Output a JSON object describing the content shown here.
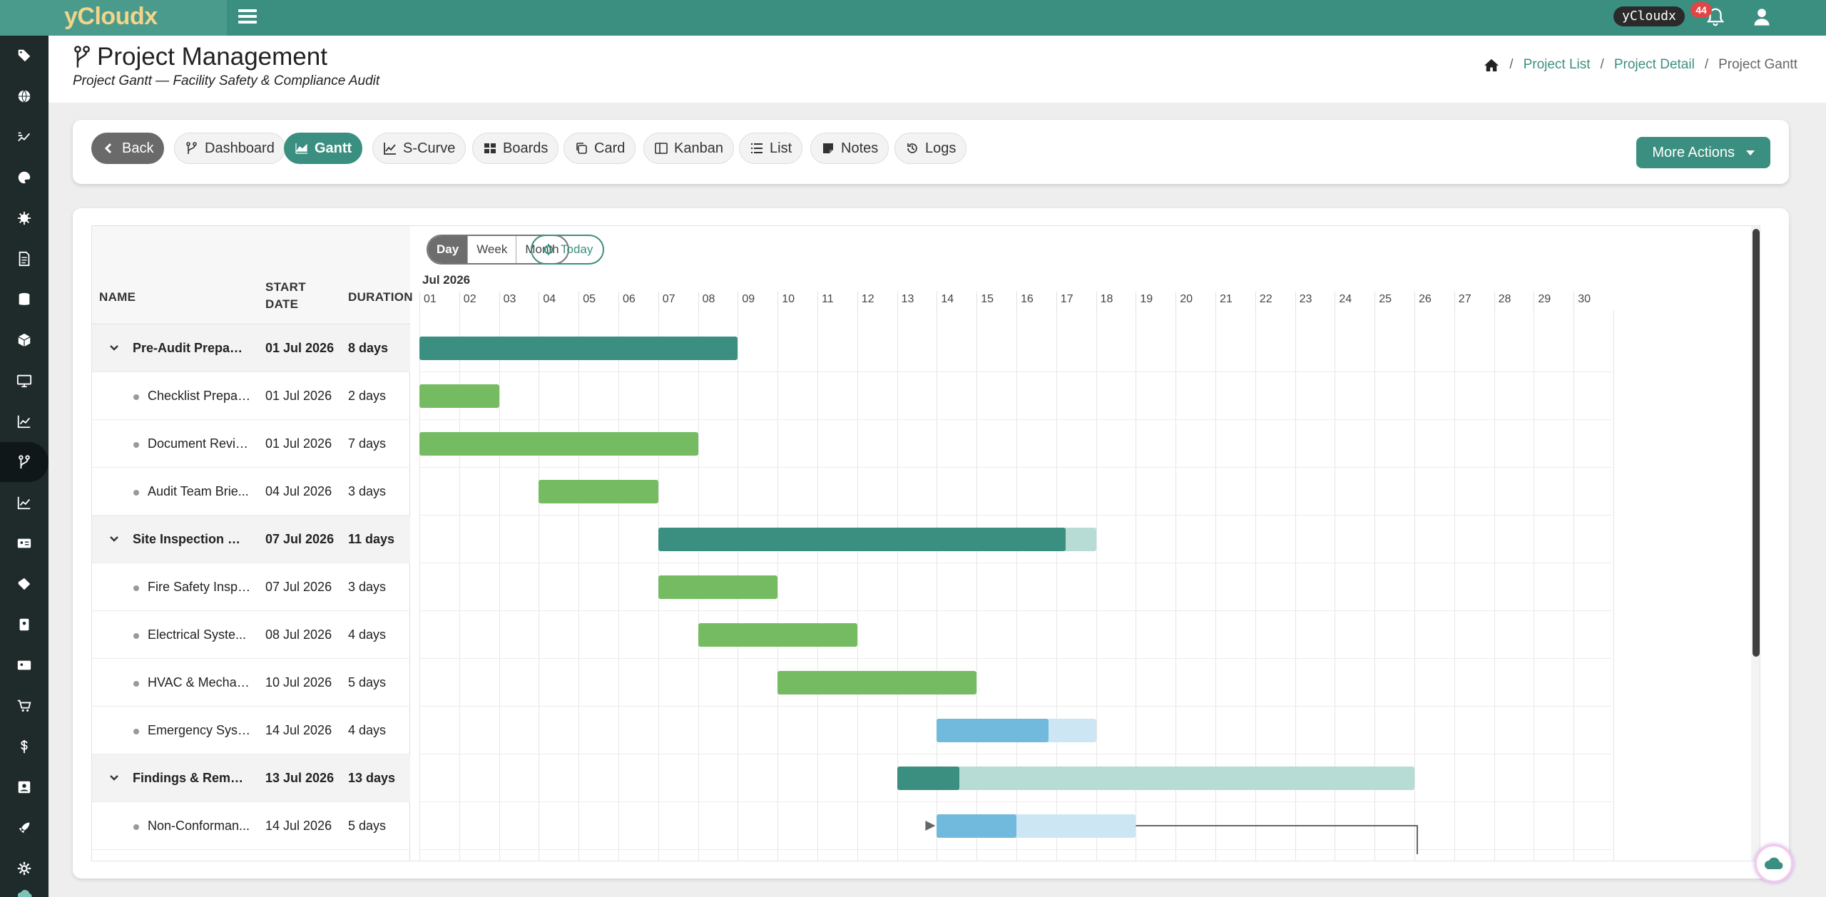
{
  "app": {
    "brand": "yCloudx",
    "user_chip": "yCloudx",
    "notification_count": "44"
  },
  "sidebar": {
    "items": [
      {
        "icon": "tag-icon"
      },
      {
        "icon": "globe-icon"
      },
      {
        "icon": "workflow-icon"
      },
      {
        "icon": "palette-icon"
      },
      {
        "icon": "gear-sun-icon"
      },
      {
        "icon": "document-icon"
      },
      {
        "icon": "database-icon"
      },
      {
        "icon": "box-icon"
      },
      {
        "icon": "monitor-icon"
      },
      {
        "icon": "chart-line-icon"
      },
      {
        "icon": "project-branch-icon",
        "active": true
      },
      {
        "icon": "chart-line-icon"
      },
      {
        "icon": "id-card-icon"
      },
      {
        "icon": "ticket-icon"
      },
      {
        "icon": "badge-icon"
      },
      {
        "icon": "contact-card-icon"
      },
      {
        "icon": "cart-icon"
      },
      {
        "icon": "dollar-icon"
      },
      {
        "icon": "person-card-icon"
      },
      {
        "icon": "rocket-icon"
      },
      {
        "icon": "settings-icon"
      },
      {
        "icon": "cloud-icon"
      }
    ]
  },
  "header": {
    "title": "Project Management",
    "subtitle": "Project Gantt — Facility Safety & Compliance Audit",
    "breadcrumb": {
      "project_list": "Project List",
      "project_detail": "Project Detail",
      "current": "Project Gantt",
      "sep": "/"
    }
  },
  "toolbar": {
    "back": "Back",
    "dashboard": "Dashboard",
    "gantt": "Gantt",
    "scurve": "S-Curve",
    "boards": "Boards",
    "card": "Card",
    "kanban": "Kanban",
    "list": "List",
    "notes": "Notes",
    "logs": "Logs",
    "more_actions": "More Actions"
  },
  "gantt": {
    "columns": {
      "name": "NAME",
      "start_line1": "START",
      "start_line2": "DATE",
      "duration": "DURATION"
    },
    "scale": {
      "day": "Day",
      "week": "Week",
      "month": "Month",
      "today": "Today",
      "active": "Day"
    },
    "month_label": "Jul 2026",
    "days": [
      "01",
      "02",
      "03",
      "04",
      "05",
      "06",
      "07",
      "08",
      "09",
      "10",
      "11",
      "12",
      "13",
      "14",
      "15",
      "16",
      "17",
      "18",
      "19",
      "20",
      "21",
      "22",
      "23",
      "24",
      "25",
      "26",
      "27",
      "28",
      "29",
      "30"
    ],
    "colors": {
      "group": "#3b8f80",
      "group_remaining": "#b7dcd6",
      "task": "#74bb62",
      "highlight": "#72b9de",
      "highlight_remaining": "#cde6f3"
    },
    "rows": [
      {
        "type": "group",
        "name": "Pre-Audit Prepara...",
        "start": "01 Jul 2026",
        "duration": "8 days",
        "bar_start_day": 1,
        "bar_days": 8,
        "progress": 1.0,
        "color": "group"
      },
      {
        "type": "child",
        "name": "Checklist Prepar...",
        "start": "01 Jul 2026",
        "duration": "2 days",
        "bar_start_day": 1,
        "bar_days": 2,
        "progress": 1.0,
        "color": "task"
      },
      {
        "type": "child",
        "name": "Document Review",
        "start": "01 Jul 2026",
        "duration": "7 days",
        "bar_start_day": 1,
        "bar_days": 7,
        "progress": 1.0,
        "color": "task"
      },
      {
        "type": "child",
        "name": "Audit Team Brie...",
        "start": "04 Jul 2026",
        "duration": "3 days",
        "bar_start_day": 4,
        "bar_days": 3,
        "progress": 1.0,
        "color": "task"
      },
      {
        "type": "group",
        "name": "Site Inspection & ...",
        "start": "07 Jul 2026",
        "duration": "11 days",
        "bar_start_day": 7,
        "bar_days": 11,
        "progress": 0.93,
        "color": "group"
      },
      {
        "type": "child",
        "name": "Fire Safety Inspe...",
        "start": "07 Jul 2026",
        "duration": "3 days",
        "bar_start_day": 7,
        "bar_days": 3,
        "progress": 1.0,
        "color": "task"
      },
      {
        "type": "child",
        "name": "Electrical Syste...",
        "start": "08 Jul 2026",
        "duration": "4 days",
        "bar_start_day": 8,
        "bar_days": 4,
        "progress": 1.0,
        "color": "task"
      },
      {
        "type": "child",
        "name": "HVAC & Mechan...",
        "start": "10 Jul 2026",
        "duration": "5 days",
        "bar_start_day": 10,
        "bar_days": 5,
        "progress": 1.0,
        "color": "task"
      },
      {
        "type": "child",
        "name": "Emergency Syst...",
        "start": "14 Jul 2026",
        "duration": "4 days",
        "bar_start_day": 14,
        "bar_days": 4,
        "progress": 0.7,
        "color": "highlight"
      },
      {
        "type": "group",
        "name": "Findings & Remed...",
        "start": "13 Jul 2026",
        "duration": "13 days",
        "bar_start_day": 13,
        "bar_days": 13,
        "progress": 0.12,
        "color": "group"
      },
      {
        "type": "child",
        "name": "Non-Conforman...",
        "start": "14 Jul 2026",
        "duration": "5 days",
        "bar_start_day": 14,
        "bar_days": 5,
        "progress": 0.4,
        "color": "highlight"
      }
    ]
  }
}
